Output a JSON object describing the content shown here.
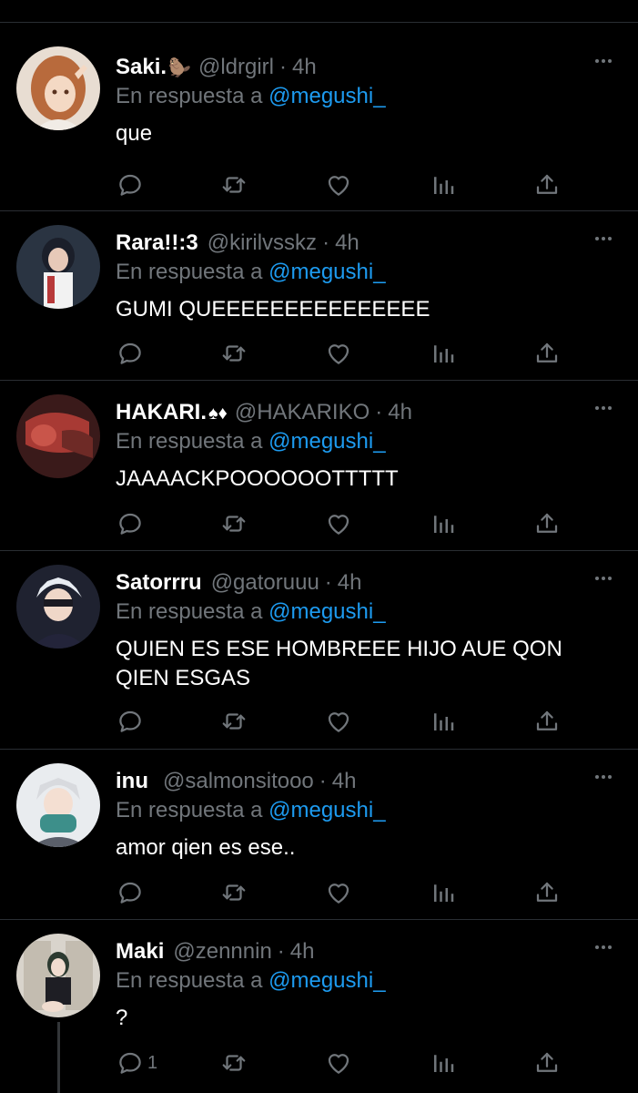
{
  "colors": {
    "background": "#000000",
    "muted": "#71767b",
    "mention": "#1d9bf0",
    "divider": "#2a2e33"
  },
  "reply_prefix": "En respuesta a",
  "reply_to": "@megushi_",
  "tweets": [
    {
      "name": "Saki.",
      "emoji": "🦫",
      "handle": "@ldrgirl",
      "time": "4h",
      "text": "que",
      "reply_count": ""
    },
    {
      "name": "Rara!!:3",
      "emoji": "",
      "handle": "@kirilvsskz",
      "time": "4h",
      "text": "GUMI QUEEEEEEEEEEEEEEE",
      "reply_count": ""
    },
    {
      "name": "HAKARI.",
      "emoji": "♠♦",
      "handle": "@HAKARIKO",
      "time": "4h",
      "text": "JAAAACKPOOOOOOTTTTT",
      "reply_count": ""
    },
    {
      "name": "Satorrru",
      "emoji": "",
      "handle": "@gatoruuu",
      "time": "4h",
      "text": "QUIEN ES ESE HOMBREEE HIJO AUE QON\nQIEN ESGAS",
      "reply_count": ""
    },
    {
      "name": "inu",
      "emoji": "",
      "handle": "@salmonsitooo",
      "time": "4h",
      "text": "amor qien es ese..",
      "reply_count": ""
    },
    {
      "name": "Maki",
      "emoji": "",
      "handle": "@zennnin",
      "time": "4h",
      "text": "?",
      "reply_count": "1"
    }
  ],
  "icons": {
    "more": "more-horizontal-icon",
    "reply": "reply-bubble-icon",
    "retweet": "retweet-icon",
    "like": "heart-icon",
    "stats": "bar-chart-icon",
    "share": "share-upload-icon"
  }
}
